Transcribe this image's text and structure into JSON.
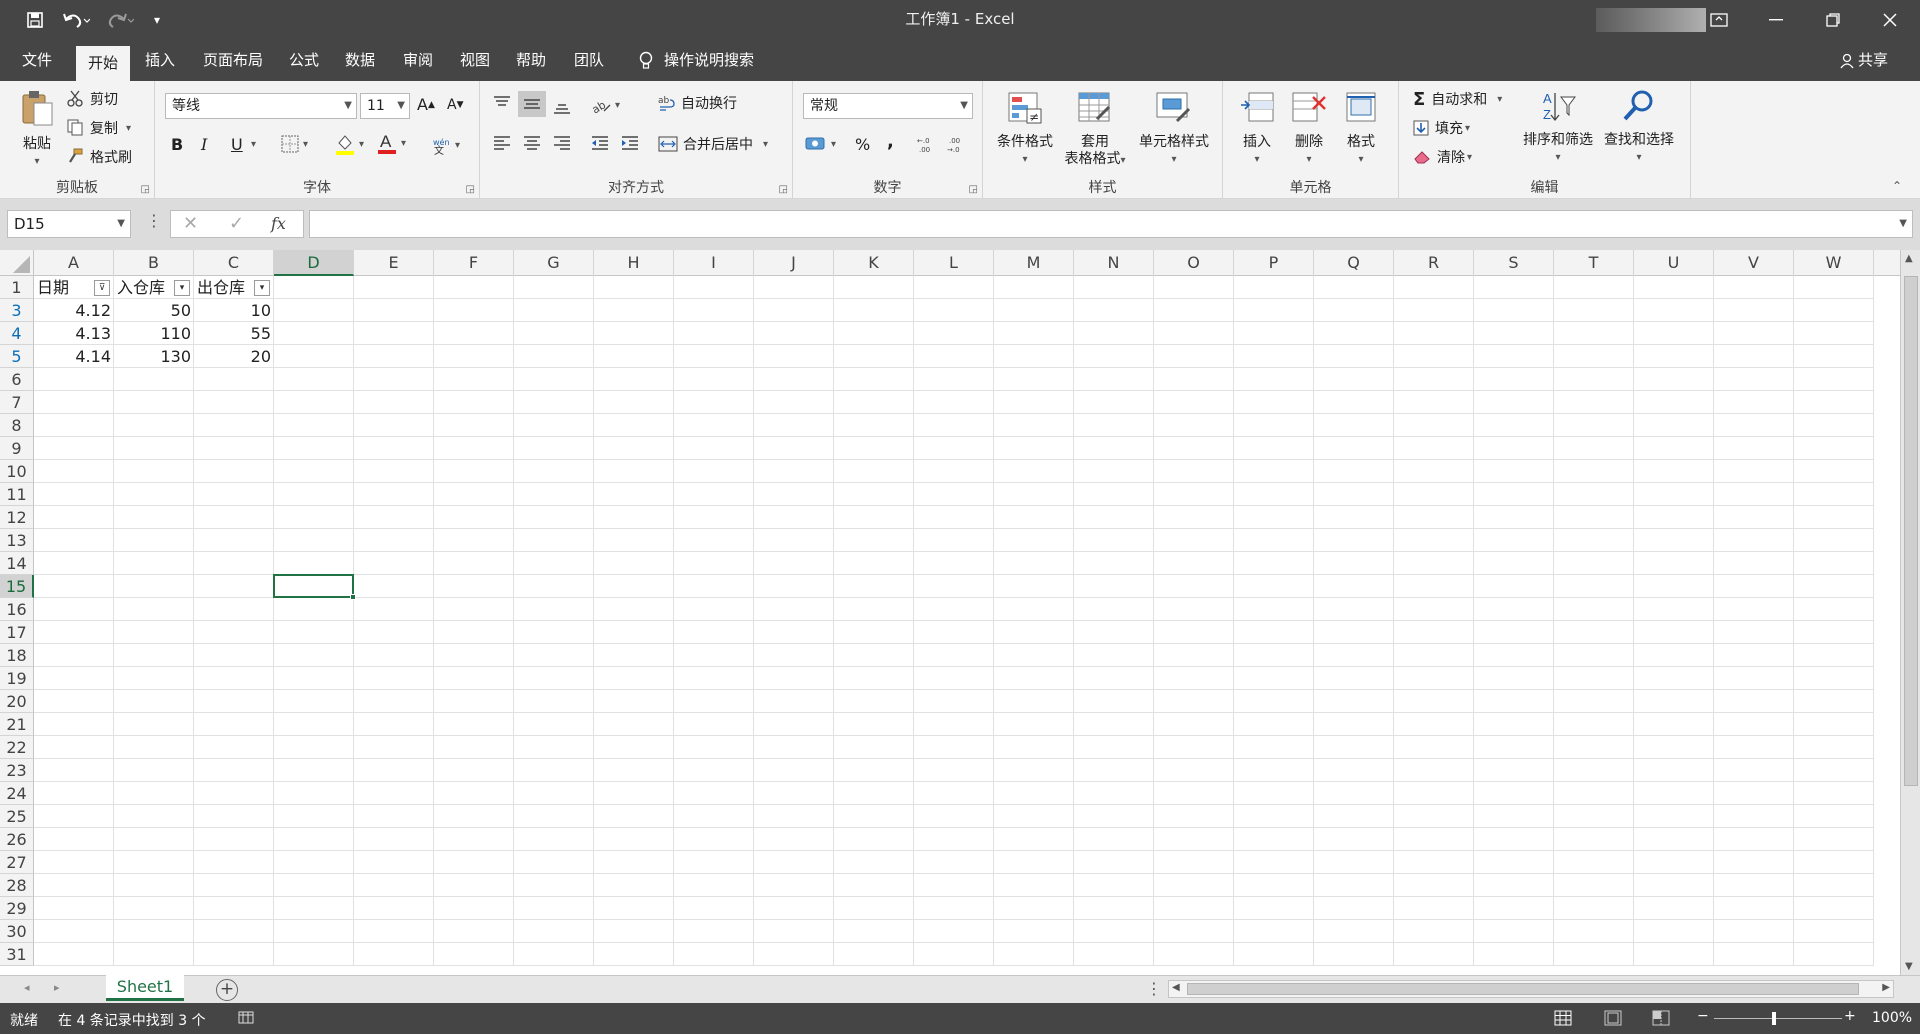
{
  "title_bar": {
    "title": "工作簿1  -  Excel"
  },
  "tabs": [
    "文件",
    "开始",
    "插入",
    "页面布局",
    "公式",
    "数据",
    "审阅",
    "视图",
    "帮助",
    "团队"
  ],
  "active_tab": "开始",
  "tell_me": "操作说明搜索",
  "share": "共享",
  "ribbon": {
    "clipboard": {
      "paste": "粘贴",
      "cut": "剪切",
      "copy": "复制",
      "format_painter": "格式刷",
      "label": "剪贴板"
    },
    "font": {
      "font_name": "等线",
      "font_size": "11",
      "bold": "B",
      "italic": "I",
      "underline": "U",
      "label": "字体"
    },
    "alignment": {
      "wrap": "自动换行",
      "merge": "合并后居中",
      "label": "对齐方式"
    },
    "number": {
      "format": "常规",
      "percent": "%",
      "comma": ",",
      "label": "数字"
    },
    "styles": {
      "conditional": "条件格式",
      "table_line1": "套用",
      "table_line2": "表格格式",
      "cell_styles": "单元格样式",
      "label": "样式"
    },
    "cells": {
      "insert": "插入",
      "delete": "删除",
      "format": "格式",
      "label": "单元格"
    },
    "editing": {
      "autosum": "自动求和",
      "fill": "填充",
      "clear": "清除",
      "sort": "排序和筛选",
      "find": "查找和选择",
      "label": "编辑"
    }
  },
  "formula_bar": {
    "name_box": "D15",
    "fx": "fx",
    "formula": ""
  },
  "grid": {
    "columns": [
      "A",
      "B",
      "C",
      "D",
      "E",
      "F",
      "G",
      "H",
      "I",
      "J",
      "K",
      "L",
      "M",
      "N",
      "O",
      "P",
      "Q",
      "R",
      "S",
      "T",
      "U",
      "V",
      "W"
    ],
    "selected_column": "D",
    "rows": [
      "1",
      "3",
      "4",
      "5",
      "6",
      "7",
      "8",
      "9",
      "10",
      "11",
      "12",
      "13",
      "14",
      "15",
      "16",
      "17",
      "18",
      "19",
      "20",
      "21",
      "22",
      "23",
      "24",
      "25",
      "26",
      "27",
      "28",
      "29",
      "30",
      "31"
    ],
    "selected_row": "15",
    "headers": [
      "日期",
      "入仓库",
      "出仓库"
    ],
    "data": [
      [
        "4.12",
        "50",
        "10"
      ],
      [
        "4.13",
        "110",
        "55"
      ],
      [
        "4.14",
        "130",
        "20"
      ]
    ]
  },
  "sheet_tabs": {
    "sheet": "Sheet1"
  },
  "status_bar": {
    "ready": "就绪",
    "found": "在 4 条记录中找到 3 个",
    "zoom": "100%"
  }
}
